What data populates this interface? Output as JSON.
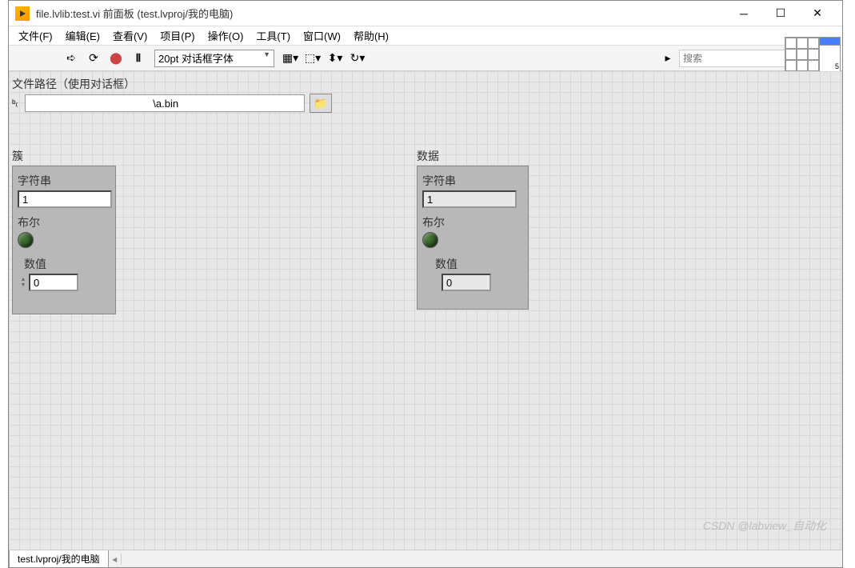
{
  "window": {
    "title": "file.lvlib:test.vi 前面板  (test.lvproj/我的电脑)"
  },
  "menu": {
    "file": "文件(F)",
    "edit": "编辑(E)",
    "view": "查看(V)",
    "project": "项目(P)",
    "operate": "操作(O)",
    "tools": "工具(T)",
    "window": "窗口(W)",
    "help": "帮助(H)"
  },
  "toolbar": {
    "font": "20pt 对话框字体",
    "search_placeholder": "搜索"
  },
  "connector": {
    "num": "5"
  },
  "controls": {
    "path_label": "文件路径（使用对话框）",
    "path_value": "                                           \\a.bin",
    "cluster1_label": "簇",
    "cluster2_label": "数据",
    "string_label": "字符串",
    "string_value1": "1",
    "string_value2": "1",
    "bool_label": "布尔",
    "num_label": "数值",
    "num_value1": "0",
    "num_value2": "0"
  },
  "statusbar": {
    "context": "test.lvproj/我的电脑"
  },
  "watermark": "CSDN @labview_自动化"
}
